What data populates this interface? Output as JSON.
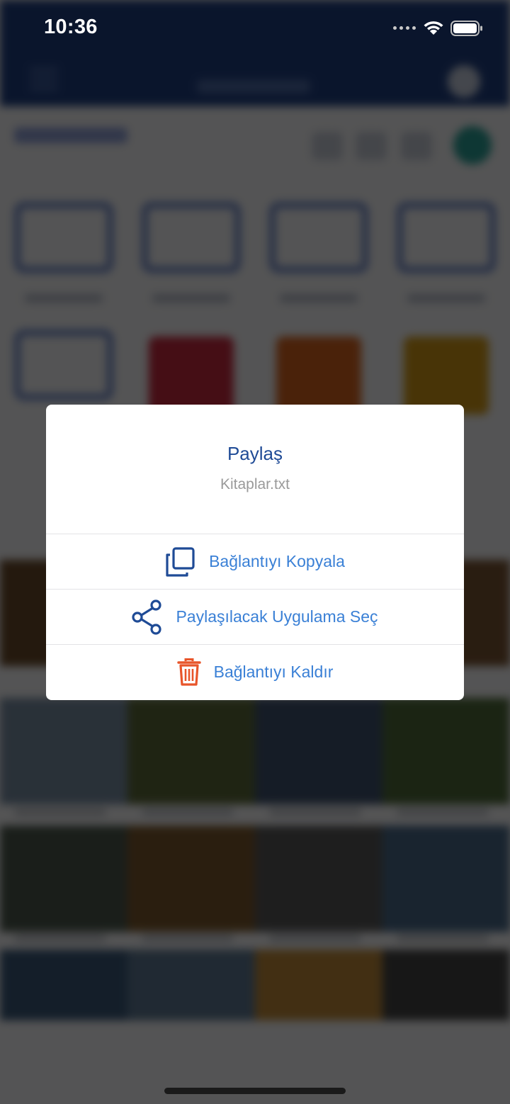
{
  "status_bar": {
    "time": "10:36"
  },
  "modal": {
    "title": "Paylaş",
    "subtitle": "Kitaplar.txt",
    "actions": [
      {
        "label": "Bağlantıyı Kopyala",
        "icon": "copy-icon",
        "color": "#3a80d6"
      },
      {
        "label": "Paylaşılacak Uygulama Seç",
        "icon": "share-icon",
        "color": "#3a80d6"
      },
      {
        "label": "Bağlantıyı Kaldır",
        "icon": "trash-icon",
        "color": "#3a80d6"
      }
    ]
  },
  "colors": {
    "navbar": "#1f3f82",
    "title": "#1f4b96",
    "action_text": "#3a80d6",
    "icon_blue": "#1f4b96",
    "trash_icon": "#e8552a",
    "overlay": "rgba(0,0,0,0.66)"
  }
}
